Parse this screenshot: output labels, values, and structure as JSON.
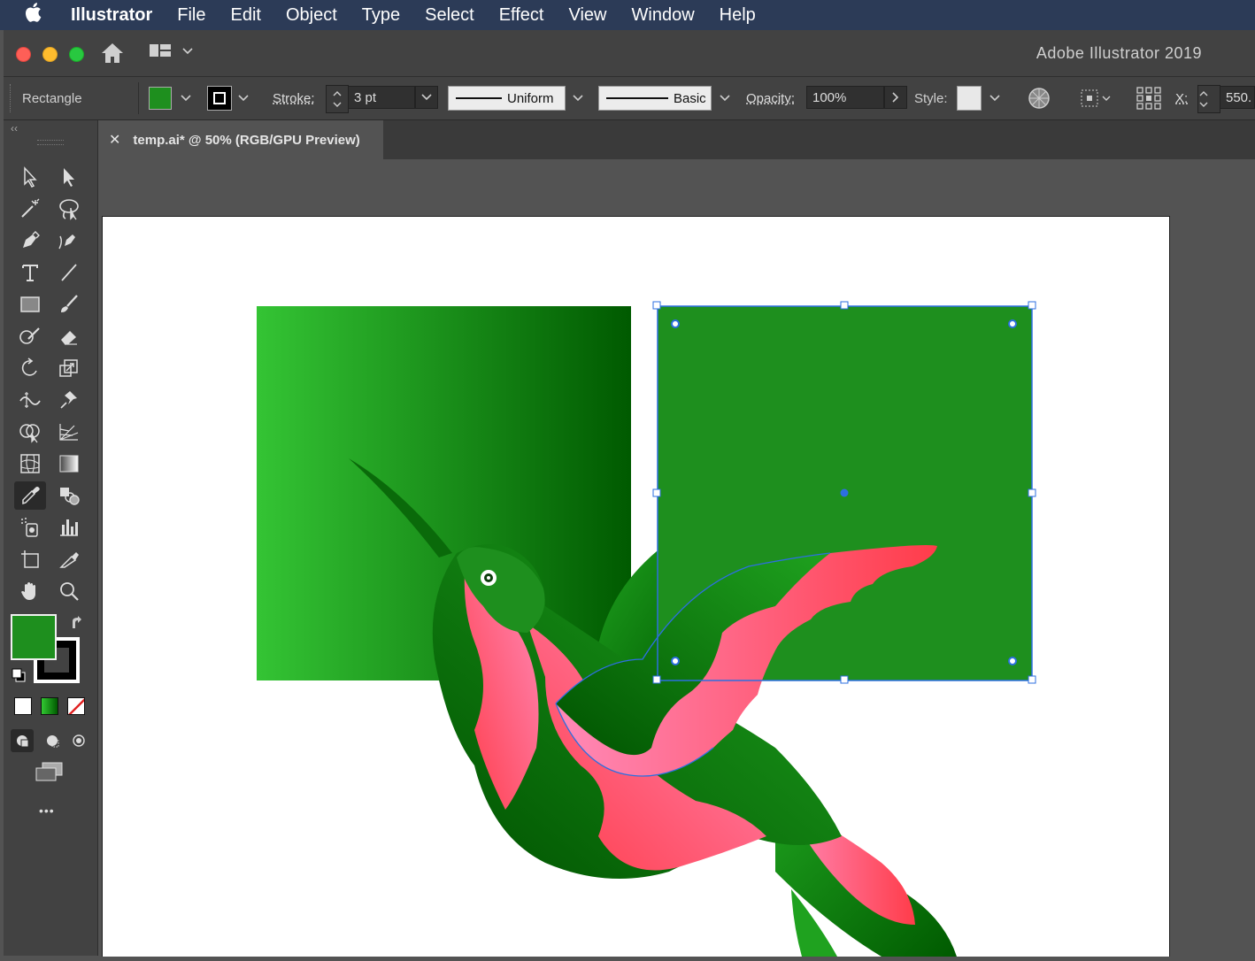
{
  "menubar": {
    "app_name": "Illustrator",
    "items": [
      "File",
      "Edit",
      "Object",
      "Type",
      "Select",
      "Effect",
      "View",
      "Window",
      "Help"
    ]
  },
  "window": {
    "title": "Adobe Illustrator 2019"
  },
  "controlbar": {
    "selection_label": "Rectangle",
    "stroke_label": "Stroke:",
    "stroke_weight": "3 pt",
    "profile_label": "Uniform",
    "brush_label": "Basic",
    "opacity_label": "Opacity:",
    "opacity_value": "100%",
    "style_label": "Style:",
    "x_label": "X:",
    "x_value": "550.",
    "fill_color": "#1e8f1e"
  },
  "document": {
    "tab_title": "temp.ai* @ 50% (RGB/GPU Preview)"
  },
  "tools": {
    "fill_color": "#1e8f1e",
    "stroke_color": "#000000",
    "more_label": "•••"
  },
  "colors": {
    "menubar_bg": "#2c3b57",
    "panel_bg": "#424242",
    "canvas_bg": "#535353",
    "selection_blue": "#2d6fe0",
    "fill_green": "#1e8f1e",
    "gradient_light": "#34c434",
    "gradient_dark": "#005a00",
    "wing_pink": "#ff3c4a",
    "wing_light_pink": "#ff8ab8"
  }
}
